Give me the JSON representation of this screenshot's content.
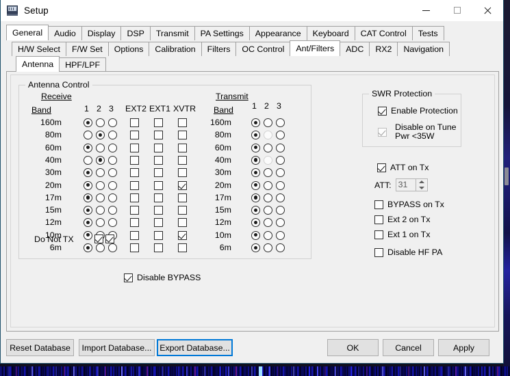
{
  "window": {
    "title": "Setup",
    "icon": "radio-console-icon",
    "caption_buttons": [
      {
        "name": "minimize",
        "glyph": "minimize-icon"
      },
      {
        "name": "maximize",
        "glyph": "maximize-icon"
      },
      {
        "name": "close",
        "glyph": "close-icon"
      }
    ]
  },
  "tabs": {
    "row1": [
      {
        "label": "General",
        "active": true
      },
      {
        "label": "Audio",
        "active": false
      },
      {
        "label": "Display",
        "active": false
      },
      {
        "label": "DSP",
        "active": false
      },
      {
        "label": "Transmit",
        "active": false
      },
      {
        "label": "PA Settings",
        "active": false
      },
      {
        "label": "Appearance",
        "active": false
      },
      {
        "label": "Keyboard",
        "active": false
      },
      {
        "label": "CAT Control",
        "active": false
      },
      {
        "label": "Tests",
        "active": false
      }
    ],
    "row2": [
      {
        "label": "H/W Select",
        "active": false
      },
      {
        "label": "F/W Set",
        "active": false
      },
      {
        "label": "Options",
        "active": false
      },
      {
        "label": "Calibration",
        "active": false
      },
      {
        "label": "Filters",
        "active": false
      },
      {
        "label": "OC Control",
        "active": false
      },
      {
        "label": "Ant/Filters",
        "active": true
      },
      {
        "label": "ADC",
        "active": false
      },
      {
        "label": "RX2",
        "active": false
      },
      {
        "label": "Navigation",
        "active": false
      }
    ],
    "row3": [
      {
        "label": "Antenna",
        "active": true
      },
      {
        "label": "HPF/LPF",
        "active": false
      }
    ]
  },
  "antenna_control": {
    "group_title": "Antenna Control",
    "receive": {
      "section_label": "Receive",
      "band_label": "Band",
      "ant_headers": [
        "1",
        "2",
        "3"
      ],
      "ext_headers": [
        "EXT2",
        "EXT1",
        "XVTR"
      ],
      "rows": [
        {
          "band": "160m",
          "ant": 1,
          "ext2": false,
          "ext1": false,
          "xvtr": false
        },
        {
          "band": "80m",
          "ant": 2,
          "ext2": false,
          "ext1": false,
          "xvtr": false
        },
        {
          "band": "60m",
          "ant": 1,
          "ext2": false,
          "ext1": false,
          "xvtr": false
        },
        {
          "band": "40m",
          "ant": 2,
          "ext2": false,
          "ext1": false,
          "xvtr": false
        },
        {
          "band": "30m",
          "ant": 1,
          "ext2": false,
          "ext1": false,
          "xvtr": false
        },
        {
          "band": "20m",
          "ant": 1,
          "ext2": false,
          "ext1": false,
          "xvtr": true
        },
        {
          "band": "17m",
          "ant": 1,
          "ext2": false,
          "ext1": false,
          "xvtr": false
        },
        {
          "band": "15m",
          "ant": 1,
          "ext2": false,
          "ext1": false,
          "xvtr": false
        },
        {
          "band": "12m",
          "ant": 1,
          "ext2": false,
          "ext1": false,
          "xvtr": false
        },
        {
          "band": "10m",
          "ant": 1,
          "ext2": false,
          "ext1": false,
          "xvtr": true
        },
        {
          "band": "6m",
          "ant": 1,
          "ext2": false,
          "ext1": false,
          "xvtr": false
        }
      ],
      "do_not_tx_label": "Do Not TX",
      "do_not_tx": [
        true,
        true
      ]
    },
    "transmit": {
      "section_label": "Transmit",
      "band_label": "Band",
      "ant_headers": [
        "1",
        "2",
        "3"
      ],
      "rows": [
        {
          "band": "160m",
          "ant": 1,
          "disabled_ant": 0
        },
        {
          "band": "80m",
          "ant": 1,
          "disabled_ant": 2
        },
        {
          "band": "60m",
          "ant": 1,
          "disabled_ant": 0
        },
        {
          "band": "40m",
          "ant": 1,
          "disabled_ant": 2
        },
        {
          "band": "30m",
          "ant": 1,
          "disabled_ant": 0
        },
        {
          "band": "20m",
          "ant": 1,
          "disabled_ant": 0
        },
        {
          "band": "17m",
          "ant": 1,
          "disabled_ant": 0
        },
        {
          "band": "15m",
          "ant": 1,
          "disabled_ant": 0
        },
        {
          "band": "12m",
          "ant": 1,
          "disabled_ant": 0
        },
        {
          "band": "10m",
          "ant": 1,
          "disabled_ant": 0
        },
        {
          "band": "6m",
          "ant": 1,
          "disabled_ant": 0
        }
      ]
    }
  },
  "disable_bypass": {
    "label": "Disable BYPASS",
    "checked": true
  },
  "swr_protection": {
    "group_title": "SWR Protection",
    "enable_protection": {
      "label": "Enable Protection",
      "checked": true,
      "disabled": false
    },
    "disable_on_tune": {
      "label_line1": "Disable on Tune",
      "label_line2": "Pwr <35W",
      "checked": true,
      "disabled": true
    }
  },
  "tx_options": {
    "att_on_tx": {
      "label": "ATT on Tx",
      "checked": true
    },
    "att": {
      "label": "ATT:",
      "value": "31",
      "disabled": true
    },
    "bypass_on_tx": {
      "label": "BYPASS on Tx",
      "checked": false
    },
    "ext2_on_tx": {
      "label": "Ext 2 on Tx",
      "checked": false
    },
    "ext1_on_tx": {
      "label": "Ext 1 on Tx",
      "checked": false
    },
    "disable_hf_pa": {
      "label": "Disable HF PA",
      "checked": false
    }
  },
  "buttons": {
    "reset_database": "Reset Database",
    "import_database": "Import Database...",
    "export_database": "Export Database...",
    "ok": "OK",
    "cancel": "Cancel",
    "apply": "Apply"
  },
  "colors": {
    "accent_focus": "#0078d7",
    "window_bg": "#f0f0f0",
    "titlebar_bg": "#ffffff",
    "tab_active_bg": "#ffffff",
    "button_bg": "#e1e1e1",
    "waterfall_blue": "#1a1ad0"
  }
}
